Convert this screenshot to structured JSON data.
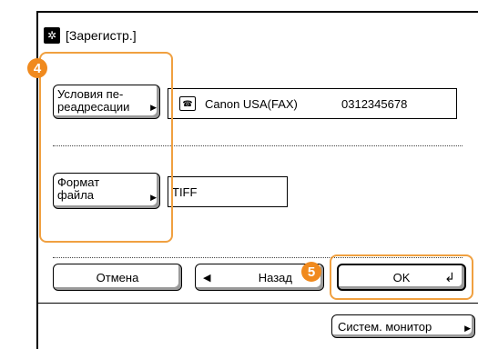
{
  "title": "[Зарегистр.]",
  "forwarding_button_label": "Условия пе-\nреадресации",
  "destination": {
    "name": "Canon USA(FAX)",
    "number": "0312345678"
  },
  "format_button_label": "Формат\nфайла",
  "format_value": "TIFF",
  "cancel_label": "Отмена",
  "back_label": "Назад",
  "ok_label": "OK",
  "monitor_label": "Систем. монитор",
  "step_badges": [
    "4",
    "5"
  ],
  "colors": {
    "highlight": "#f0a040",
    "badge": "#f08a1e"
  }
}
